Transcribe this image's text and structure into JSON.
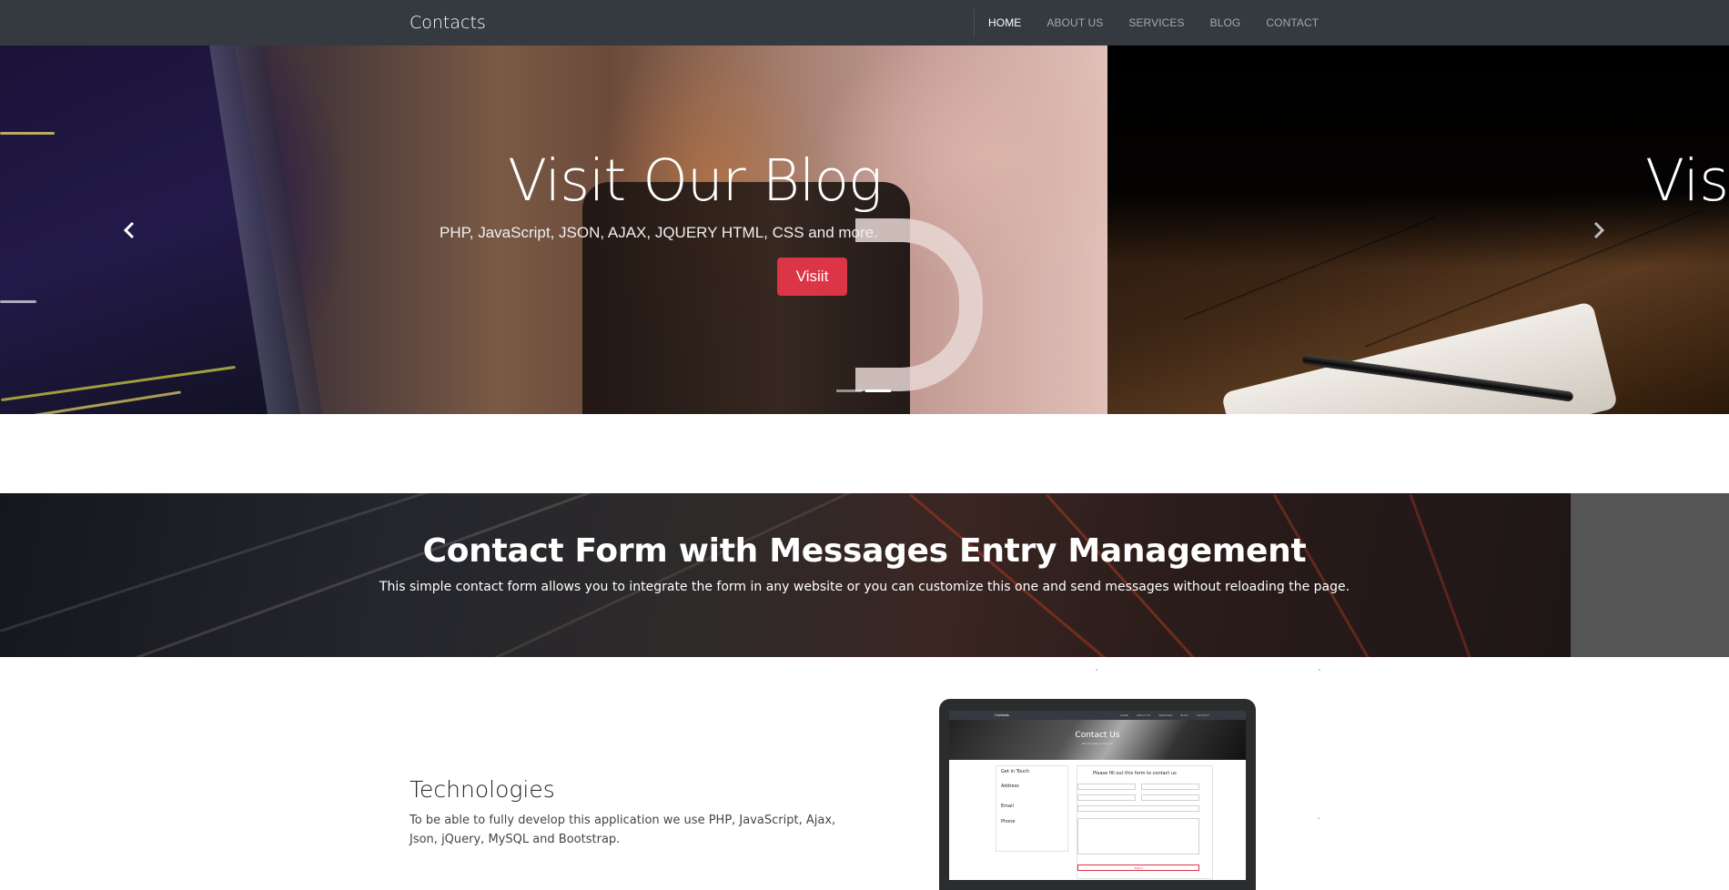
{
  "navbar": {
    "brand": "Contacts",
    "links": [
      {
        "label": "HOME",
        "active": true
      },
      {
        "label": "ABOUT US",
        "active": false
      },
      {
        "label": "SERVICES",
        "active": false
      },
      {
        "label": "BLOG",
        "active": false
      },
      {
        "label": "CONTACT",
        "active": false
      }
    ]
  },
  "carousel": {
    "active_slide": {
      "title": "Visit Our Blog",
      "subtitle": "PHP, JavaScript, JSON, AJAX, JQUERY HTML, CSS and more.",
      "button_label": "Visiit"
    },
    "next_slide_title_visible": "Visi",
    "prev_icon": "chevron-left-icon",
    "next_icon": "chevron-right-icon",
    "indicator_count": 2,
    "active_indicator": 2
  },
  "banner": {
    "title": "Contact Form with Messages Entry Management",
    "subtitle": "This simple contact form allows you to integrate the form in any website or you can customize this one and send messages without reloading the page."
  },
  "technologies": {
    "title": "Technologies",
    "text": "To be able to fully develop this application we use PHP, JavaScript, Ajax, Json, jQuery, MySQL and Bootstrap."
  },
  "mockup": {
    "brand": "Contacts",
    "nav_links": [
      "HOME",
      "ABOUT US",
      "SERVICES",
      "BLOG",
      "CONTACT"
    ],
    "hero_title": "Contact Us",
    "hero_subtitle": "We are happy to help you",
    "left_card": {
      "get_in_touch": "Get in Touch",
      "address": "Address",
      "email": "Email",
      "phone": "Phone"
    },
    "form_heading": "Please fill out this form to contact us",
    "submit_label": "Submit"
  },
  "colors": {
    "navbar_bg": "#343a40",
    "accent_red": "#dc3545",
    "banner_side": "#555555"
  }
}
